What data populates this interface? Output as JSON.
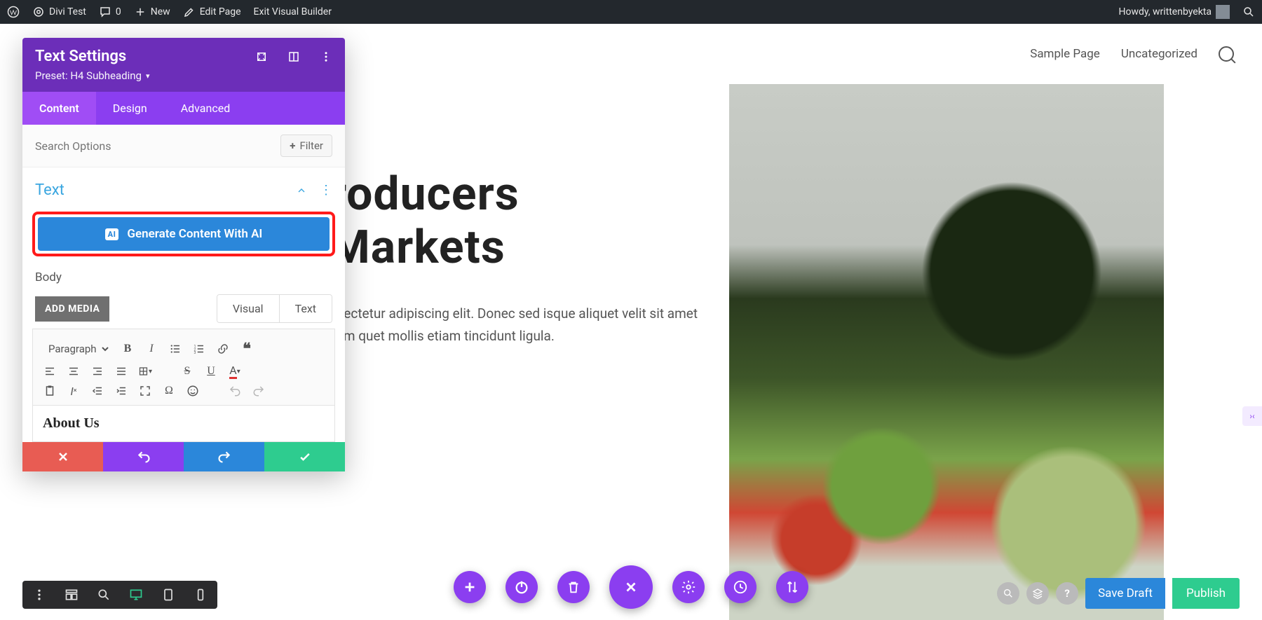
{
  "adminBar": {
    "siteName": "Divi Test",
    "comments": "0",
    "new": "New",
    "editPage": "Edit Page",
    "exitVB": "Exit Visual Builder",
    "howdy": "Howdy, writtenbyekta"
  },
  "topNav": {
    "items": [
      "Sample Page",
      "Uncategorized"
    ]
  },
  "page": {
    "headingLine1": "roducers",
    "headingLine2": "Markets",
    "paragraph": "nsectetur adipiscing elit. Donec sed isque aliquet velit sit amet sem quet mollis etiam tincidunt ligula."
  },
  "panel": {
    "title": "Text Settings",
    "preset": "Preset: H4 Subheading",
    "tabs": [
      "Content",
      "Design",
      "Advanced"
    ],
    "searchPlaceholder": "Search Options",
    "filterLabel": "Filter",
    "sectionTitle": "Text",
    "aiButton": "Generate Content With AI",
    "aiBadge": "AI",
    "bodyLabel": "Body",
    "addMedia": "ADD MEDIA",
    "editorTabs": [
      "Visual",
      "Text"
    ],
    "formatSelect": "Paragraph",
    "editorContent": "About Us"
  },
  "bottomRight": {
    "saveDraft": "Save Draft",
    "publish": "Publish",
    "help": "?"
  },
  "colors": {
    "purple": "#8b3ef0",
    "darkPurple": "#6c2eb9",
    "blue": "#2b87da",
    "green": "#2ecc8f",
    "red": "#e85c53",
    "highlightRed": "#ff1a1a"
  }
}
